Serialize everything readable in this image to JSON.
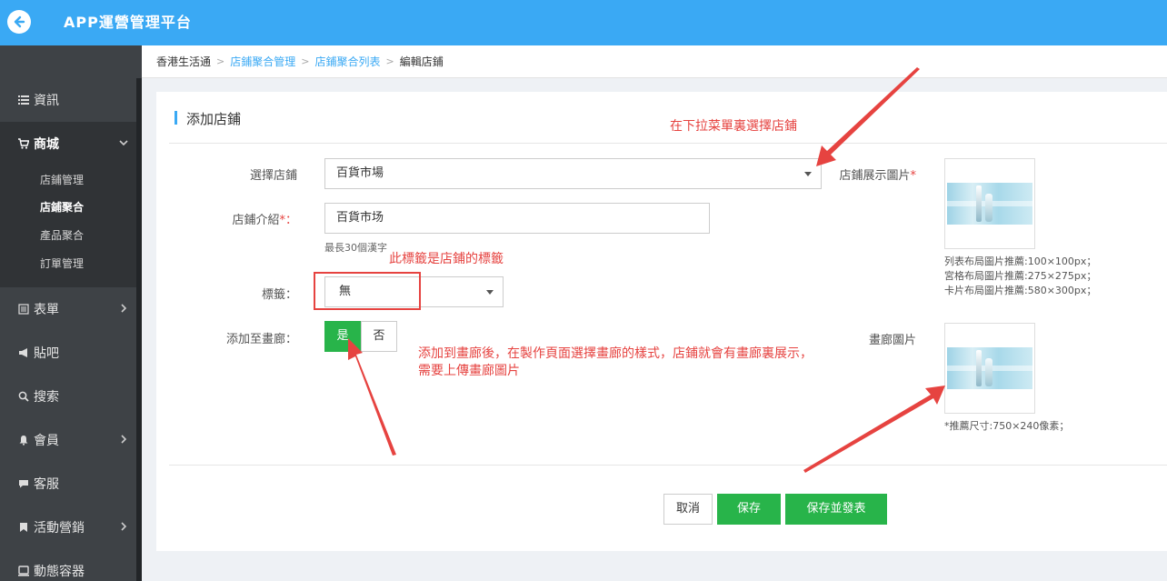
{
  "header": {
    "title": "APP運營管理平台",
    "back_icon": "arrow-left-icon",
    "bg_color": "#3aa9f4"
  },
  "sidebar": {
    "items": [
      {
        "label": "資訊",
        "icon": "list-icon"
      },
      {
        "label": "商城",
        "icon": "cart-icon"
      },
      {
        "label": "表單",
        "icon": "form-icon"
      },
      {
        "label": "貼吧",
        "icon": "megaphone-icon"
      },
      {
        "label": "搜索",
        "icon": "search-icon"
      },
      {
        "label": "會員",
        "icon": "bell-icon"
      },
      {
        "label": "客服",
        "icon": "chat-icon"
      },
      {
        "label": "活動營銷",
        "icon": "bookmark-icon"
      },
      {
        "label": "動態容器",
        "icon": "container-icon"
      }
    ],
    "sub_items": [
      "店鋪管理",
      "店鋪聚合",
      "產品聚合",
      "訂單管理"
    ]
  },
  "breadcrumb": [
    "香港生活通",
    "店鋪聚合管理",
    "店鋪聚合列表",
    "編輯店鋪"
  ],
  "panel": {
    "title": "添加店鋪",
    "fields": {
      "shop_label": "選擇店鋪",
      "shop_value": "百貨市場",
      "intro_label": "店鋪介紹",
      "intro_req": "*：",
      "intro_value": "百貨市场",
      "intro_hint": "最長30個漢字",
      "tag_label": "標籤：",
      "tag_value": "無",
      "gallery_label": "添加至畫廊：",
      "toggle_yes": "是",
      "toggle_no": "否",
      "display_img_label": "店鋪展示圖片",
      "display_img_req": "*",
      "display_img_notes": [
        "列表布局圖片推薦:100×100px；",
        "宮格布局圖片推薦:275×275px；",
        "卡片布局圖片推薦:580×300px；"
      ],
      "gallery_img_label": "畫廊圖片",
      "gallery_img_note": "*推薦尺寸:750×240像素；"
    },
    "buttons": {
      "cancel": "取消",
      "save": "保存",
      "save_publish": "保存並發表"
    }
  },
  "annotations": {
    "select_hint": "在下拉菜單裏選擇店鋪",
    "tag_hint": "此標籤是店鋪的標籤",
    "gallery_hint_line1": "添加到畫廊後，在製作頁面選擇畫廊的樣式，店鋪就會有畫廊裏展示，",
    "gallery_hint_line2": "需要上傳畫廊圖片",
    "color": "#e64340"
  },
  "colors": {
    "accent": "#3aa9f4",
    "green": "#28b44a",
    "sidebar": "#3e4246"
  }
}
